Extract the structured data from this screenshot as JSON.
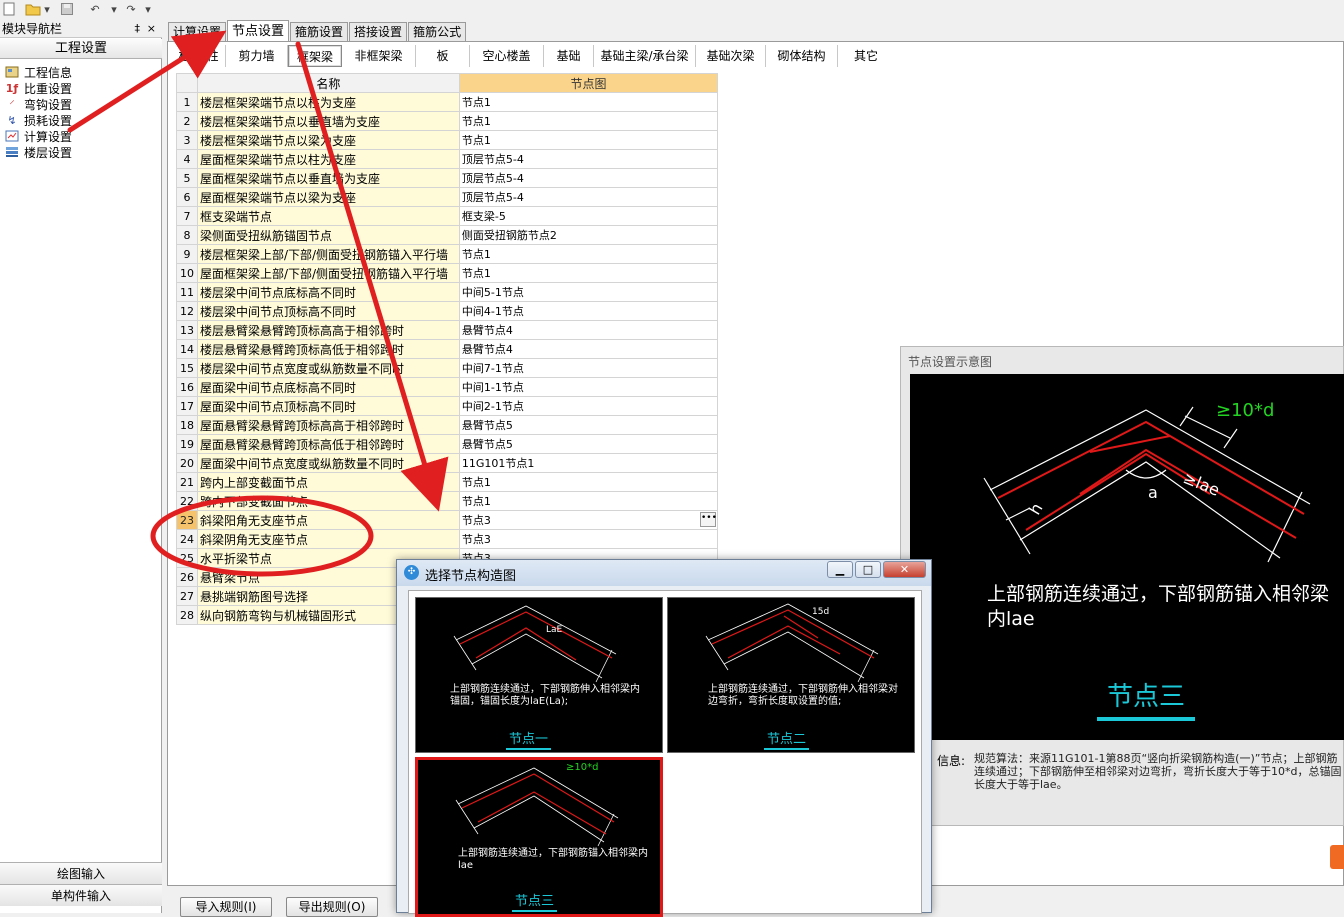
{
  "nav_panel": {
    "title": "模块导航栏",
    "pin": "‡",
    "close": "×",
    "section_title": "工程设置",
    "items": [
      {
        "label": "工程信息",
        "icon": "info-icon"
      },
      {
        "label": "比重设置",
        "icon": "density-icon"
      },
      {
        "label": "弯钩设置",
        "icon": "hook-icon"
      },
      {
        "label": "损耗设置",
        "icon": "loss-icon"
      },
      {
        "label": "计算设置",
        "icon": "calc-icon"
      },
      {
        "label": "楼层设置",
        "icon": "floor-icon"
      }
    ],
    "bottom_buttons": [
      "绘图输入",
      "单构件输入"
    ]
  },
  "main_tabs": [
    "计算设置",
    "节点设置",
    "箍筋设置",
    "搭接设置",
    "箍筋公式"
  ],
  "active_main_tab": 1,
  "sub_tabs": [
    "柱/墙柱",
    "剪力墙",
    "框架梁",
    "非框架梁",
    "板",
    "空心楼盖",
    "基础",
    "基础主梁/承台梁",
    "基础次梁",
    "砌体结构",
    "其它"
  ],
  "active_sub_tab": 2,
  "grid": {
    "headers": {
      "name": "名称",
      "node": "节点图"
    },
    "selected_row": 23,
    "rows": [
      {
        "num": "1",
        "name": "楼层框架梁端节点以柱为支座",
        "node": "节点1"
      },
      {
        "num": "2",
        "name": "楼层框架梁端节点以垂直墙为支座",
        "node": "节点1"
      },
      {
        "num": "3",
        "name": "楼层框架梁端节点以梁为支座",
        "node": "节点1"
      },
      {
        "num": "4",
        "name": "屋面框架梁端节点以柱为支座",
        "node": "顶层节点5-4"
      },
      {
        "num": "5",
        "name": "屋面框架梁端节点以垂直墙为支座",
        "node": "顶层节点5-4"
      },
      {
        "num": "6",
        "name": "屋面框架梁端节点以梁为支座",
        "node": "顶层节点5-4"
      },
      {
        "num": "7",
        "name": "框支梁端节点",
        "node": "框支梁-5"
      },
      {
        "num": "8",
        "name": "梁侧面受扭纵筋锚固节点",
        "node": "侧面受扭钢筋节点2"
      },
      {
        "num": "9",
        "name": "楼层框架梁上部/下部/侧面受扭钢筋锚入平行墙",
        "node": "节点1"
      },
      {
        "num": "10",
        "name": "屋面框架梁上部/下部/侧面受扭钢筋锚入平行墙",
        "node": "节点1"
      },
      {
        "num": "11",
        "name": "楼层梁中间节点底标高不同时",
        "node": "中间5-1节点"
      },
      {
        "num": "12",
        "name": "楼层梁中间节点顶标高不同时",
        "node": "中间4-1节点"
      },
      {
        "num": "13",
        "name": "楼层悬臂梁悬臂跨顶标高高于相邻跨时",
        "node": "悬臂节点4"
      },
      {
        "num": "14",
        "name": "楼层悬臂梁悬臂跨顶标高低于相邻跨时",
        "node": "悬臂节点4"
      },
      {
        "num": "15",
        "name": "楼层梁中间节点宽度或纵筋数量不同时",
        "node": "中间7-1节点"
      },
      {
        "num": "16",
        "name": "屋面梁中间节点底标高不同时",
        "node": "中间1-1节点"
      },
      {
        "num": "17",
        "name": "屋面梁中间节点顶标高不同时",
        "node": "中间2-1节点"
      },
      {
        "num": "18",
        "name": "屋面悬臂梁悬臂跨顶标高高于相邻跨时",
        "node": "悬臂节点5"
      },
      {
        "num": "19",
        "name": "屋面悬臂梁悬臂跨顶标高低于相邻跨时",
        "node": "悬臂节点5"
      },
      {
        "num": "20",
        "name": "屋面梁中间节点宽度或纵筋数量不同时",
        "node": "11G101节点1"
      },
      {
        "num": "21",
        "name": "跨内上部变截面节点",
        "node": "节点1"
      },
      {
        "num": "22",
        "name": "跨内下部变截面节点",
        "node": "节点1"
      },
      {
        "num": "23",
        "name": "斜梁阳角无支座节点",
        "node": "节点3"
      },
      {
        "num": "24",
        "name": "斜梁阴角无支座节点",
        "node": "节点3"
      },
      {
        "num": "25",
        "name": "水平折梁节点",
        "node": "节点3"
      },
      {
        "num": "26",
        "name": "悬臂梁节点",
        "node": ""
      },
      {
        "num": "27",
        "name": "悬挑端钢筋图号选择",
        "node": ""
      },
      {
        "num": "28",
        "name": "纵向钢筋弯钩与机械锚固形式",
        "node": ""
      }
    ]
  },
  "preview": {
    "title": "节点设置示意图",
    "dim_label": "≥10*d",
    "lae_label": "≥lae",
    "h_label": "h",
    "a_label": "a",
    "description": "上部钢筋连续通过，下部钢筋锚入相邻梁内lae",
    "node_name": "节点三",
    "info_label": "信息:",
    "info_text": "规范算法：来源11G101-1第88页“竖向折梁钢筋构造(一)”节点；上部钢筋连续通过；下部钢筋伸至相邻梁对边弯折，弯折长度大于等于10*d，总锚固长度大于等于lae。"
  },
  "bottom_buttons": [
    "导入规则(I)",
    "导出规则(O)"
  ],
  "dialog": {
    "title": "选择节点构造图",
    "options": [
      {
        "text": "上部钢筋连续通过，下部钢筋伸入相邻梁内锚固，锚固长度为laE(La);",
        "name": "节点一",
        "label": "LaE"
      },
      {
        "text": "上部钢筋连续通过，下部钢筋伸入相邻梁对边弯折，弯折长度取设置的值;",
        "name": "节点二",
        "label": "15d"
      },
      {
        "text": "上部钢筋连续通过，下部钢筋锚入相邻梁内lae",
        "name": "节点三",
        "label": "≥10*d"
      }
    ],
    "selected": 2
  },
  "colors": {
    "accent_header": "#fbd48c",
    "name_cell": "#fffbd9",
    "cad_red": "#e01818",
    "cad_cyan": "#1ac8d8",
    "cad_green": "#22d322",
    "annotation_red": "#e02020"
  }
}
